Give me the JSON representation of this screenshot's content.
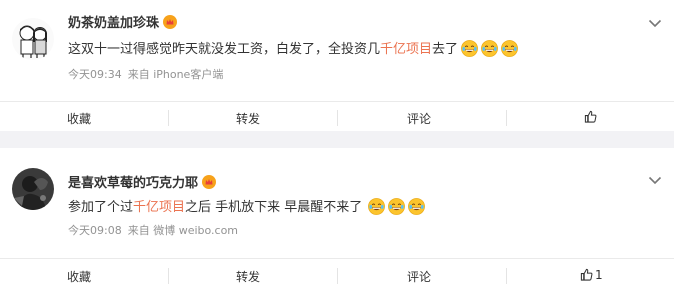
{
  "posts": [
    {
      "username": "奶茶奶盖加珍珠",
      "avatar_icon": "cartoon-couple-avatar",
      "badge_icon": "vip-crown-icon",
      "content_before": "这双十一过得感觉昨天就没发工资，白发了，全投资几",
      "content_highlight": "千亿项目",
      "content_after": "去了",
      "emoji_count": 3,
      "emoji_icon": "laughing-tears-emoji",
      "time": "今天09:34",
      "source": "来自 iPhone客户端",
      "actions": {
        "favorite": "收藏",
        "repost": "转发",
        "comment": "评论",
        "like": ""
      }
    },
    {
      "username": "是喜欢草莓的巧克力耶",
      "avatar_icon": "dark-photo-avatar",
      "badge_icon": "vip-crown-icon",
      "content_before": "参加了个过",
      "content_highlight": "千亿项目",
      "content_after": "之后 手机放下来 早晨醒不来了",
      "emoji_count": 3,
      "emoji_icon": "laughing-tears-emoji",
      "time": "今天09:08",
      "source": "来自 微博 weibo.com",
      "actions": {
        "favorite": "收藏",
        "repost": "转发",
        "comment": "评论",
        "like": "1"
      }
    }
  ],
  "colors": {
    "highlight": "#eb7350",
    "meta": "#939393",
    "gap": "#f2f2f5"
  }
}
